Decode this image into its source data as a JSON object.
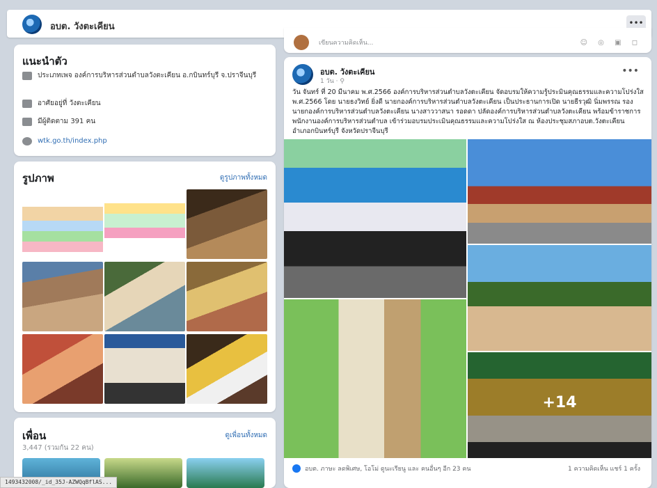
{
  "header": {
    "page_name": "อบต. วังตะเคียน",
    "more_label": "•••"
  },
  "intro": {
    "title": "แนะนำตัว",
    "rows": [
      {
        "icon": "building-icon",
        "text": "ประเภทเพจ องค์การบริหารส่วนตำบลวังตะเคียน อ.กบินทร์บุรี จ.ปราจีนบุรี"
      },
      {
        "icon": "home-icon",
        "text": "อาศัยอยู่ที่ วังตะเคียน"
      },
      {
        "icon": "followers-icon",
        "text": "มีผู้ติดตาม 391 คน"
      },
      {
        "icon": "link-icon",
        "text": "wtk.go.th/index.php"
      }
    ]
  },
  "photos": {
    "title": "รูปภาพ",
    "see_all": "ดูรูปภาพทั้งหมด"
  },
  "friends": {
    "title": "เพื่อน",
    "see_all": "ดูเพื่อนทั้งหมด",
    "count": "3,447 (รวมกัน 22 คน)"
  },
  "prev_post": {
    "snippet": "เขียนความคิดเห็น...",
    "icons": "☺ ◎ ▣ ◻"
  },
  "post": {
    "author": "อบต. วังตะเคียน",
    "meta": "1 วัน · ⚲",
    "more": "•••",
    "text": "วัน จันทร์ ที่ 20 มีนาคม พ.ศ.2566 องค์การบริหารส่วนตำบลวังตะเคียน จัดอบรมให้ความรู้ประมินคุณธรรมและความโปร่งใส พ.ศ.2566 โดย นายธงวิทย์ ยิ่งดี นายกองค์การบริหารส่วนตำบลวังตะเคียน เป็นประธานการเปิด นายธีรวุฒิ นิ่มพรรณ รองนายกองค์การบริหารส่วนตำบลวังตะเคียน นางสาววาสนา รอดดา ปลัดองค์การบริหารส่วนตำบลวังตะเคียน พร้อมข้าราชการพนักงานองค์การบริหารส่วนตำบล เข้าร่วมอบรมประเมินคุณธรรมและความโปร่งใส ณ ห้องประชุมสภาอบต.วังตะเคียน อำเภอกบินทร์บุรี จังหวัดปราจีนบุรี",
    "more_photos": "+14",
    "reactions": "อบต. ภาษะ ลดพิเศษ, โอโม่ ดูนะเรียนู และ คนอื่นๆ อีก 23 คน",
    "comments": "1 ความคิดเห็น   แชร์ 1 ครั้ง"
  },
  "status_url": "1493432008/_id_35J-AZWQqBflAS..."
}
